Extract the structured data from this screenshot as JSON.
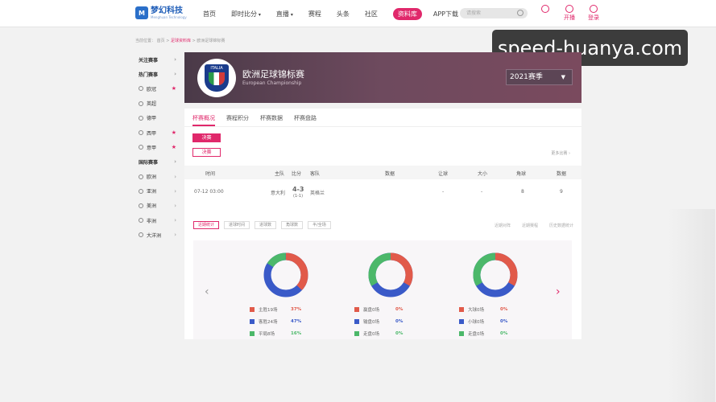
{
  "brand": {
    "name": "梦幻科技",
    "tagline": "Menghuan Technology",
    "mark": "M"
  },
  "nav": {
    "items": [
      {
        "label": "首页",
        "caret": false,
        "active": false
      },
      {
        "label": "即时比分",
        "caret": true,
        "active": false
      },
      {
        "label": "直播",
        "caret": true,
        "active": false
      },
      {
        "label": "赛程",
        "caret": false,
        "active": false
      },
      {
        "label": "头条",
        "caret": false,
        "active": false
      },
      {
        "label": "社区",
        "caret": false,
        "active": false
      },
      {
        "label": "资料库",
        "caret": false,
        "active": true
      },
      {
        "label": "APP下载",
        "caret": false,
        "active": false
      }
    ],
    "search_placeholder": "请搜索",
    "actions": {
      "register": "开播",
      "login": "登录"
    }
  },
  "watermark": "speed-huanya.com",
  "breadcrumb": {
    "prefix": "当前位置：",
    "home": "首页",
    "sep1": " > ",
    "section": "足球资料库",
    "sep2": " > ",
    "current": "欧洲足球锦标赛"
  },
  "sidebar": {
    "items": [
      {
        "label": "关注赛事",
        "type": "head",
        "marker": "›"
      },
      {
        "label": "热门赛事",
        "type": "head",
        "marker": "›"
      },
      {
        "label": "欧冠",
        "type": "item",
        "marker": "★"
      },
      {
        "label": "英超",
        "type": "item",
        "marker": ""
      },
      {
        "label": "德甲",
        "type": "item",
        "marker": ""
      },
      {
        "label": "西甲",
        "type": "item",
        "marker": "★"
      },
      {
        "label": "意甲",
        "type": "item",
        "marker": "★"
      },
      {
        "label": "国际赛事",
        "type": "head",
        "marker": "›"
      },
      {
        "label": "欧洲",
        "type": "item",
        "marker": "›"
      },
      {
        "label": "亚洲",
        "type": "item",
        "marker": "›"
      },
      {
        "label": "美洲",
        "type": "item",
        "marker": "›"
      },
      {
        "label": "非洲",
        "type": "item",
        "marker": "›"
      },
      {
        "label": "大洋洲",
        "type": "item",
        "marker": "›"
      }
    ]
  },
  "banner": {
    "badge_text": "ITALIA",
    "title": "欧洲足球锦标赛",
    "subtitle": "European Championship",
    "season": "2021赛季"
  },
  "panel": {
    "tabs": [
      "杯赛概况",
      "赛程积分",
      "杯赛数据",
      "杯赛盘路"
    ],
    "stages": [
      "决赛",
      "决赛"
    ],
    "more": "更多比赛 ›",
    "columns": [
      "时间",
      "主队",
      "比分",
      "客队",
      "数据",
      "让球",
      "大小",
      "角球",
      "数据"
    ],
    "match": {
      "time": "07-12 03:00",
      "home": "意大利",
      "score": "4-3",
      "half": "(1-1)",
      "away": "英格兰",
      "handicap": "-",
      "total": "-",
      "corners": "8",
      "data": "9"
    },
    "filters": [
      "近期统计",
      "进球时间",
      "进球数",
      "角球数",
      "半/全场"
    ],
    "filter_options": [
      "近期对阵",
      "近期赛程",
      "历史数据统计"
    ]
  },
  "stats": {
    "groups": [
      {
        "legend": [
          {
            "label": "主胜19场",
            "pct": "37%",
            "color": "#e15a4a"
          },
          {
            "label": "客胜24场",
            "pct": "47%",
            "color": "#3a5ac8"
          },
          {
            "label": "平局8场",
            "pct": "16%",
            "color": "#4cb86a"
          }
        ]
      },
      {
        "legend": [
          {
            "label": "赢盘0场",
            "pct": "0%",
            "color": "#e15a4a"
          },
          {
            "label": "输盘0场",
            "pct": "0%",
            "color": "#3a5ac8"
          },
          {
            "label": "走盘0场",
            "pct": "0%",
            "color": "#4cb86a"
          }
        ]
      },
      {
        "legend": [
          {
            "label": "大球0场",
            "pct": "0%",
            "color": "#e15a4a"
          },
          {
            "label": "小球0场",
            "pct": "0%",
            "color": "#3a5ac8"
          },
          {
            "label": "走盘0场",
            "pct": "0%",
            "color": "#4cb86a"
          }
        ]
      }
    ],
    "prev_icon": "chevron-left-icon",
    "next_icon": "chevron-right-icon"
  },
  "colors": {
    "accent": "#e0286b",
    "brand": "#1e5db8"
  }
}
